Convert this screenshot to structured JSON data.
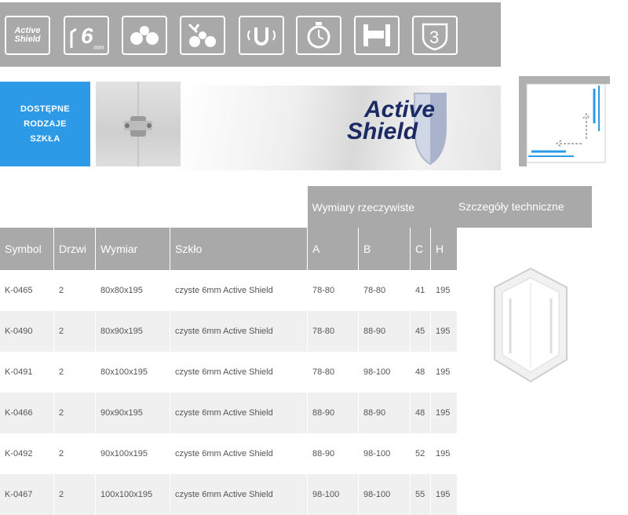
{
  "icons": [
    {
      "name": "active-shield-icon",
      "text": "Active Shield"
    },
    {
      "name": "6mm-glass-icon",
      "text": "6",
      "sub": "mm"
    },
    {
      "name": "double-roller-icon"
    },
    {
      "name": "lift-roller-icon"
    },
    {
      "name": "magnet-icon"
    },
    {
      "name": "clock-icon"
    },
    {
      "name": "profile-icon"
    },
    {
      "name": "shield-3-icon"
    }
  ],
  "banner": {
    "glass_label_lines": [
      "DOSTĘPNE",
      "RODZAJE",
      "SZKŁA"
    ],
    "brand_line1": "Active",
    "brand_line2": "Shield"
  },
  "table": {
    "group_header": "Wymiary rzeczywiste",
    "spec_header": "Szczegóły techniczne",
    "columns": [
      "Symbol",
      "Drzwi",
      "Wymiar",
      "Szkło",
      "A",
      "B",
      "C",
      "H"
    ],
    "rows": [
      [
        "K-0465",
        "2",
        "80x80x195",
        "czyste 6mm Active Shield",
        "78-80",
        "78-80",
        "41",
        "195"
      ],
      [
        "K-0490",
        "2",
        "80x90x195",
        "czyste 6mm Active Shield",
        "78-80",
        "88-90",
        "45",
        "195"
      ],
      [
        "K-0491",
        "2",
        "80x100x195",
        "czyste 6mm Active Shield",
        "78-80",
        "98-100",
        "48",
        "195"
      ],
      [
        "K-0466",
        "2",
        "90x90x195",
        "czyste 6mm Active Shield",
        "88-90",
        "88-90",
        "48",
        "195"
      ],
      [
        "K-0492",
        "2",
        "90x100x195",
        "czyste 6mm Active Shield",
        "88-90",
        "98-100",
        "52",
        "195"
      ],
      [
        "K-0467",
        "2",
        "100x100x195",
        "czyste 6mm Active Shield",
        "98-100",
        "98-100",
        "55",
        "195"
      ]
    ]
  },
  "colors": {
    "header_gray": "#a9a9a9",
    "glass_blue": "#2c9ae6",
    "brand_navy": "#1b2a63"
  }
}
